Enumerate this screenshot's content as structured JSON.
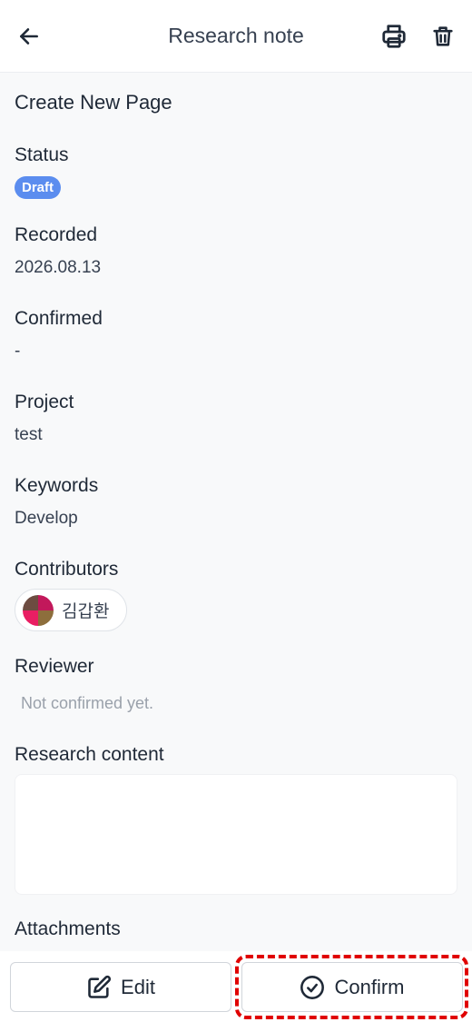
{
  "header": {
    "title": "Research note",
    "back_icon": "arrow-left-icon",
    "print_icon": "printer-icon",
    "delete_icon": "trash-icon"
  },
  "page": {
    "title": "Create New Page"
  },
  "fields": {
    "status_label": "Status",
    "status_value": "Draft",
    "recorded_label": "Recorded",
    "recorded_value": "2026.08.13",
    "confirmed_label": "Confirmed",
    "confirmed_value": "-",
    "project_label": "Project",
    "project_value": "test",
    "keywords_label": "Keywords",
    "keywords_value": "Develop",
    "contributors_label": "Contributors",
    "contributor_name": "김갑환",
    "reviewer_label": "Reviewer",
    "reviewer_value": "Not confirmed yet.",
    "research_content_label": "Research content",
    "attachments_label": "Attachments"
  },
  "footer": {
    "edit_label": "Edit",
    "confirm_label": "Confirm"
  },
  "colors": {
    "badge": "#5b8def",
    "highlight": "#e00000"
  }
}
